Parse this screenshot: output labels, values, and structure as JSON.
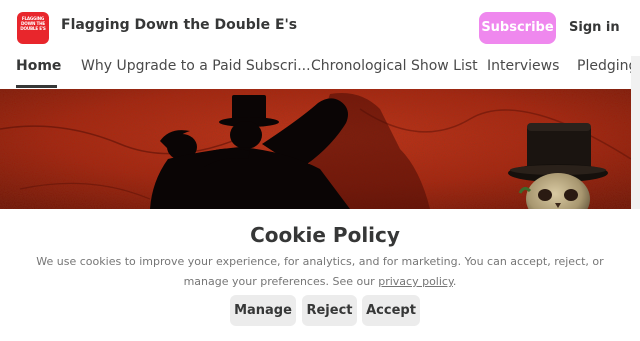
{
  "header": {
    "logo_text": "FLAGGING\nDOWN THE\nDOUBLE E'S",
    "title": "Flagging Down the Double E's",
    "subscribe_label": "Subscribe",
    "signin_label": "Sign in"
  },
  "nav": {
    "items": [
      {
        "label": "Home",
        "active": true
      },
      {
        "label": "Why Upgrade to a Paid Subscri..."
      },
      {
        "label": "Chronological Show List"
      },
      {
        "label": "Interviews"
      },
      {
        "label": "Pledging"
      }
    ]
  },
  "hero": {
    "image_description": "Red textured wall with silhouette of dancing couple and skull wearing top hat"
  },
  "cookie": {
    "title": "Cookie Policy",
    "text_before_link": "We use cookies to improve your experience, for analytics, and for marketing. You can accept, reject, or manage your preferences. See our ",
    "link_text": "privacy policy",
    "text_after_link": ".",
    "buttons": {
      "manage": "Manage",
      "reject": "Reject",
      "accept": "Accept"
    }
  },
  "colors": {
    "brand_red": "#e8262c",
    "subscribe_pink": "#ef88ee",
    "hero_red": "#b5250f",
    "text_dark": "#363737",
    "text_muted": "#767676",
    "button_gray": "#ececec"
  }
}
